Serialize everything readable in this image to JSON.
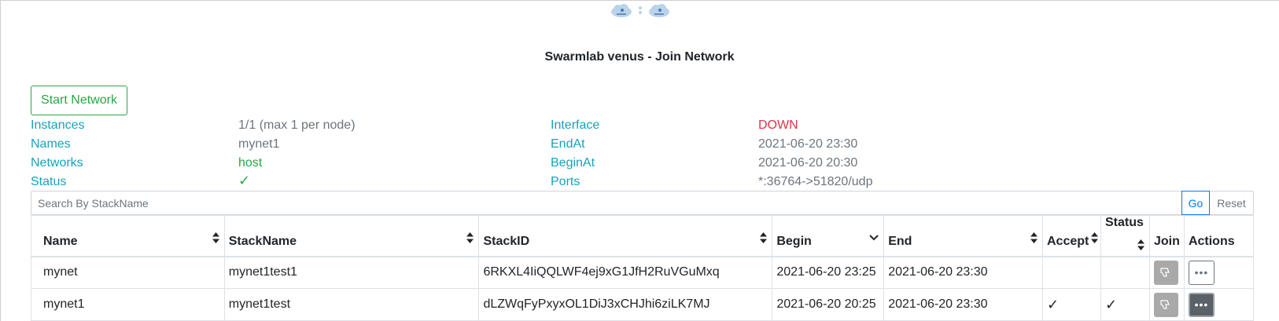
{
  "header": {
    "title": "Swarmlab venus - Join Network",
    "logo_icon": "cloud-network-icon"
  },
  "actions": {
    "start_network_label": "Start Network"
  },
  "info_left": [
    {
      "label": "Instances",
      "value": "1/1 (max 1 per node)"
    },
    {
      "label": "Names",
      "value": "mynet1"
    },
    {
      "label": "Networks",
      "value": "host"
    },
    {
      "label": "Status",
      "value": "✓"
    }
  ],
  "info_right": [
    {
      "label": "Interface",
      "value": "DOWN"
    },
    {
      "label": "EndAt",
      "value": "2021-06-20 23:30"
    },
    {
      "label": "BeginAt",
      "value": "2021-06-20 20:30"
    },
    {
      "label": "Ports",
      "value": "*:36764->51820/udp"
    }
  ],
  "search": {
    "placeholder": "Search By StackName",
    "value": "",
    "go_label": "Go",
    "reset_label": "Reset"
  },
  "table": {
    "columns": [
      "Name",
      "StackName",
      "StackID",
      "Begin",
      "End",
      "Accept",
      "Status",
      "Join",
      "Actions"
    ],
    "rows": [
      {
        "name": "mynet",
        "stackname": "mynet1test1",
        "stackid": "6RKXL4IiQQLWF4ej9xG1JfH2RuVGuMxq",
        "begin": "2021-06-20 23:25",
        "end": "2021-06-20 23:30",
        "accept": "",
        "status": "",
        "actions_label": "•••"
      },
      {
        "name": "mynet1",
        "stackname": "mynet1test",
        "stackid": "dLZWqFyPxyxOL1DiJ3xCHJhi6ziLK7MJ",
        "begin": "2021-06-20 20:25",
        "end": "2021-06-20 23:30",
        "accept": "✓",
        "status": "✓",
        "actions_label": "•••"
      }
    ]
  },
  "colors": {
    "label": "#17a2b8",
    "success": "#28a745",
    "danger": "#dc3545",
    "muted": "#6c757d",
    "primary": "#007bff"
  }
}
